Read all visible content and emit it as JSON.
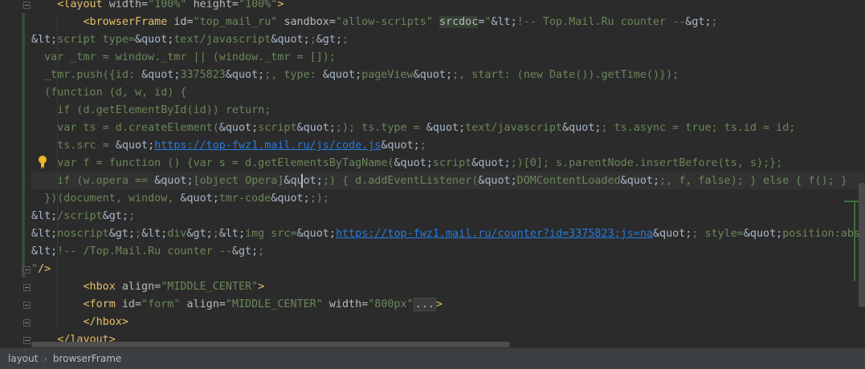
{
  "editor": {
    "lines": [
      [
        {
          "c": "t-tag",
          "t": "    <layout "
        },
        {
          "c": "t-attr",
          "t": "width="
        },
        {
          "c": "t-str",
          "t": "\"100%\" "
        },
        {
          "c": "t-attr",
          "t": "height="
        },
        {
          "c": "t-str",
          "t": "\"100%\""
        },
        {
          "c": "t-tag",
          "t": ">"
        }
      ],
      [
        {
          "c": "t-tag",
          "t": "        <browserFrame "
        },
        {
          "c": "t-attr",
          "t": "id="
        },
        {
          "c": "t-str",
          "t": "\"top_mail_ru\" "
        },
        {
          "c": "t-attr",
          "t": "sandbox="
        },
        {
          "c": "t-str",
          "t": "\"allow-scripts\" "
        },
        {
          "c": "t-attr hl-word",
          "t": "srcdoc"
        },
        {
          "c": "t-attr",
          "t": "="
        },
        {
          "c": "t-str",
          "t": "\""
        },
        {
          "c": "t-amp",
          "t": "&lt;"
        },
        {
          "c": "t-code",
          "t": "!-- Top.Mail.Ru counter --"
        },
        {
          "c": "t-amp",
          "t": "&gt;"
        },
        {
          "c": "t-code",
          "t": ";"
        }
      ],
      [
        {
          "c": "t-amp",
          "t": "&lt;"
        },
        {
          "c": "t-code",
          "t": "script type="
        },
        {
          "c": "t-amp",
          "t": "&quot;"
        },
        {
          "c": "t-code",
          "t": "text/javascript"
        },
        {
          "c": "t-amp",
          "t": "&quot;"
        },
        {
          "c": "t-code",
          "t": ";"
        },
        {
          "c": "t-amp",
          "t": "&gt;"
        },
        {
          "c": "t-code",
          "t": ";"
        }
      ],
      [
        {
          "c": "t-code",
          "t": "  var _tmr = window._tmr || (window._tmr = []);"
        }
      ],
      [
        {
          "c": "t-code",
          "t": "  _tmr.push({id: "
        },
        {
          "c": "t-amp",
          "t": "&quot;"
        },
        {
          "c": "t-code",
          "t": "3375823"
        },
        {
          "c": "t-amp",
          "t": "&quot;"
        },
        {
          "c": "t-code",
          "t": ";, type: "
        },
        {
          "c": "t-amp",
          "t": "&quot;"
        },
        {
          "c": "t-code",
          "t": "pageView"
        },
        {
          "c": "t-amp",
          "t": "&quot;"
        },
        {
          "c": "t-code",
          "t": ";, start: (new Date()).getTime()});"
        }
      ],
      [
        {
          "c": "t-code",
          "t": "  (function (d, w, id) {"
        }
      ],
      [
        {
          "c": "t-code",
          "t": "    if (d.getElementById(id)) return;"
        }
      ],
      [
        {
          "c": "t-code",
          "t": "    var ts = d.createElement("
        },
        {
          "c": "t-amp",
          "t": "&quot;"
        },
        {
          "c": "t-code",
          "t": "script"
        },
        {
          "c": "t-amp",
          "t": "&quot;"
        },
        {
          "c": "t-code",
          "t": ";); ts.type = "
        },
        {
          "c": "t-amp",
          "t": "&quot;"
        },
        {
          "c": "t-code",
          "t": "text/javascript"
        },
        {
          "c": "t-amp",
          "t": "&quot;"
        },
        {
          "c": "t-code",
          "t": "; ts.async = true; ts.id = id;"
        }
      ],
      [
        {
          "c": "t-code",
          "t": "    ts.src = "
        },
        {
          "c": "t-amp",
          "t": "&quot;"
        },
        {
          "c": "t-url",
          "t": "https://top-fwz1.mail.ru/js/code.js"
        },
        {
          "c": "t-amp",
          "t": "&quot;"
        },
        {
          "c": "t-code",
          "t": ";"
        }
      ],
      [
        {
          "c": "t-code",
          "t": "    var f = function () {var s = d.getElementsByTagName("
        },
        {
          "c": "t-amp",
          "t": "&quot;"
        },
        {
          "c": "t-code",
          "t": "script"
        },
        {
          "c": "t-amp",
          "t": "&quot;"
        },
        {
          "c": "t-code",
          "t": ";)[0]; s.parentNode.insertBefore(ts, s);};"
        }
      ],
      [
        {
          "c": "t-code",
          "t": "    if (w.opera == "
        },
        {
          "c": "t-amp",
          "t": "&quot;"
        },
        {
          "c": "t-code",
          "t": "[object Opera]"
        },
        {
          "c": "t-amp",
          "t": "&quot;"
        },
        {
          "c": "t-code",
          "t": ";) { d.addEventListener("
        },
        {
          "c": "t-amp",
          "t": "&quot;"
        },
        {
          "c": "t-code",
          "t": "DOMContentLoaded"
        },
        {
          "c": "t-amp",
          "t": "&quot;"
        },
        {
          "c": "t-code",
          "t": ";, f, false); } else { f(); }"
        }
      ],
      [
        {
          "c": "t-code",
          "t": "  })(document, window, "
        },
        {
          "c": "t-amp",
          "t": "&quot;"
        },
        {
          "c": "t-code",
          "t": "tmr-code"
        },
        {
          "c": "t-amp",
          "t": "&quot;"
        },
        {
          "c": "t-code",
          "t": ";);"
        }
      ],
      [
        {
          "c": "t-amp",
          "t": "&lt;"
        },
        {
          "c": "t-code",
          "t": "/script"
        },
        {
          "c": "t-amp",
          "t": "&gt;"
        },
        {
          "c": "t-code",
          "t": ";"
        }
      ],
      [
        {
          "c": "t-amp",
          "t": "&lt;"
        },
        {
          "c": "t-code",
          "t": "noscript"
        },
        {
          "c": "t-amp",
          "t": "&gt;"
        },
        {
          "c": "t-code",
          "t": ";"
        },
        {
          "c": "t-amp",
          "t": "&lt;"
        },
        {
          "c": "t-code",
          "t": "div"
        },
        {
          "c": "t-amp",
          "t": "&gt;"
        },
        {
          "c": "t-code",
          "t": ";"
        },
        {
          "c": "t-amp",
          "t": "&lt;"
        },
        {
          "c": "t-code",
          "t": "img src="
        },
        {
          "c": "t-amp",
          "t": "&quot;"
        },
        {
          "c": "t-url",
          "t": "https://top-fwz1.mail.ru/counter?id=3375823;js=na"
        },
        {
          "c": "t-amp",
          "t": "&quot;"
        },
        {
          "c": "t-code",
          "t": "; style="
        },
        {
          "c": "t-amp",
          "t": "&quot;"
        },
        {
          "c": "t-code",
          "t": "position:absolut"
        }
      ],
      [
        {
          "c": "t-amp",
          "t": "&lt;"
        },
        {
          "c": "t-code",
          "t": "!-- /Top.Mail.Ru counter --"
        },
        {
          "c": "t-amp",
          "t": "&gt;"
        },
        {
          "c": "t-code",
          "t": ";"
        }
      ],
      [
        {
          "c": "t-str",
          "t": "\""
        },
        {
          "c": "t-tag",
          "t": "/>"
        }
      ],
      [
        {
          "c": "t-tag",
          "t": "        <hbox "
        },
        {
          "c": "t-attr",
          "t": "align="
        },
        {
          "c": "t-str",
          "t": "\"MIDDLE_CENTER\""
        },
        {
          "c": "t-tag",
          "t": ">"
        }
      ],
      [
        {
          "c": "t-tag",
          "t": "        <form "
        },
        {
          "c": "t-attr",
          "t": "id="
        },
        {
          "c": "t-str",
          "t": "\"form\" "
        },
        {
          "c": "t-attr",
          "t": "align="
        },
        {
          "c": "t-str",
          "t": "\"MIDDLE_CENTER\" "
        },
        {
          "c": "t-attr",
          "t": "width="
        },
        {
          "c": "t-str",
          "t": "\"800px\""
        },
        {
          "c": "t-fold",
          "t": "..."
        },
        {
          "c": "t-tag",
          "t": ">"
        }
      ],
      [
        {
          "c": "t-tag",
          "t": "        </hbox>"
        }
      ],
      [
        {
          "c": "t-tag",
          "t": "    </layout>"
        }
      ]
    ]
  },
  "breadcrumbs": {
    "items": [
      "layout",
      "browserFrame"
    ]
  }
}
